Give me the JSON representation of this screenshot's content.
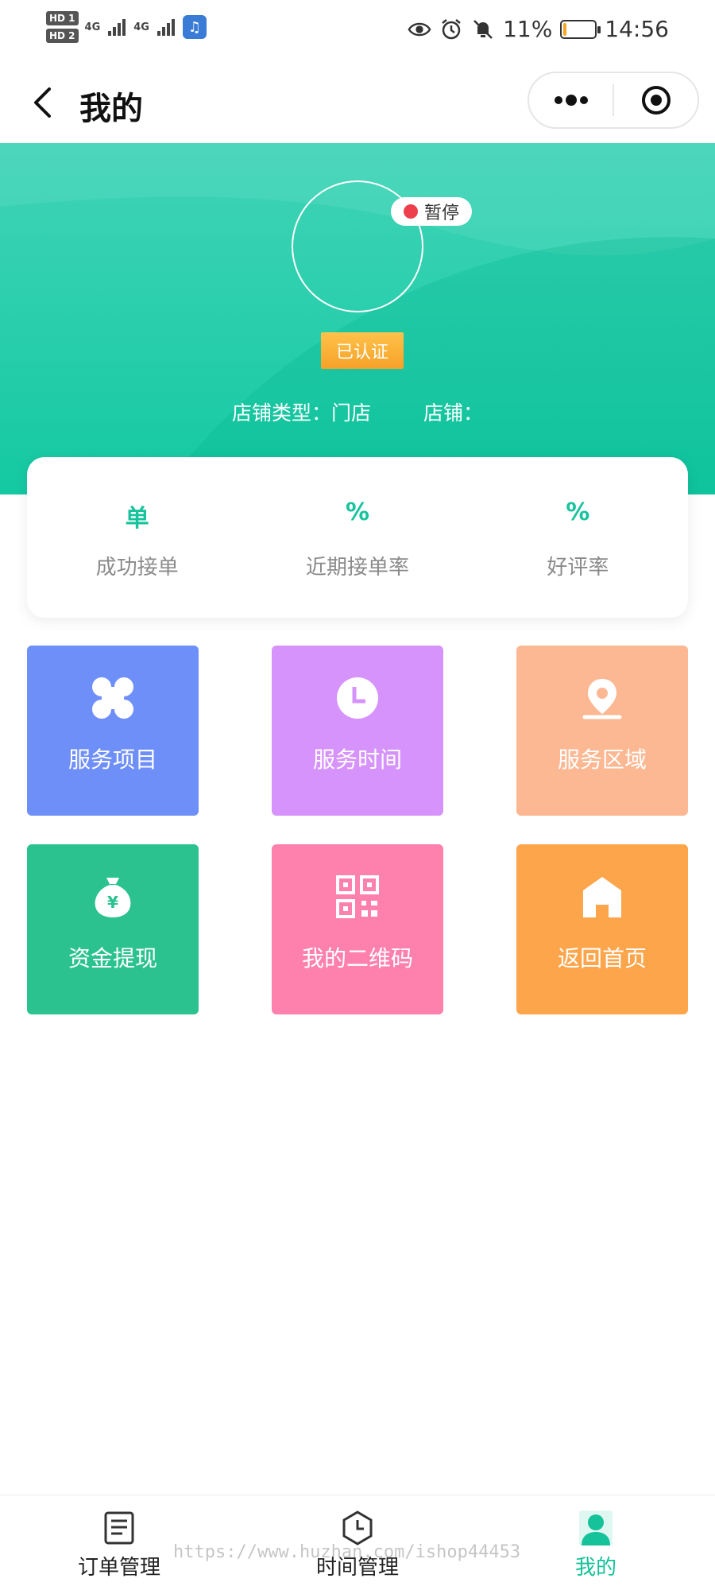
{
  "status_bar": {
    "hd1": "HD 1",
    "hd2": "HD 2",
    "signal1": "4G",
    "signal2": "4G",
    "battery_percent": "11%",
    "battery_level": 0.11,
    "time": "14:56",
    "icons": [
      "eye-icon",
      "alarm-icon",
      "mute-bell-icon"
    ]
  },
  "nav": {
    "title": "我的",
    "back_icon": "chevron-left-icon",
    "more_icon": "more-dots-icon",
    "close_icon": "target-circle-icon"
  },
  "profile": {
    "status": "暂停",
    "verified": "已认证",
    "shop_type": "店铺类型：门店",
    "shop_name": "店铺："
  },
  "stats": [
    {
      "value": "单",
      "label": "成功接单"
    },
    {
      "value": "%",
      "label": "近期接单率"
    },
    {
      "value": "%",
      "label": "好评率"
    }
  ],
  "menu": [
    {
      "label": "服务项目",
      "icon": "clover-icon",
      "color": "#6f8ff8"
    },
    {
      "label": "服务时间",
      "icon": "clock-icon",
      "color": "#d793fc"
    },
    {
      "label": "服务区域",
      "icon": "location-pin-icon",
      "color": "#fbb892"
    },
    {
      "label": "资金提现",
      "icon": "money-bag-icon",
      "color": "#2bc290"
    },
    {
      "label": "我的二维码",
      "icon": "qr-code-icon",
      "color": "#fe80ac"
    },
    {
      "label": "返回首页",
      "icon": "home-icon",
      "color": "#fda54b"
    }
  ],
  "tabs": [
    {
      "label": "订单管理",
      "icon": "order-list-icon"
    },
    {
      "label": "时间管理",
      "icon": "clock-shield-icon"
    },
    {
      "label": "我的",
      "icon": "user-icon",
      "active": true
    }
  ],
  "watermark": "https://www.huzhan.com/ishop44453",
  "colors": {
    "accent": "#15c29a",
    "header_top": "#40d4b7",
    "header_bottom": "#14c9a2",
    "status_dot": "#ee3f4d",
    "verified_badge": "#f7a128"
  }
}
